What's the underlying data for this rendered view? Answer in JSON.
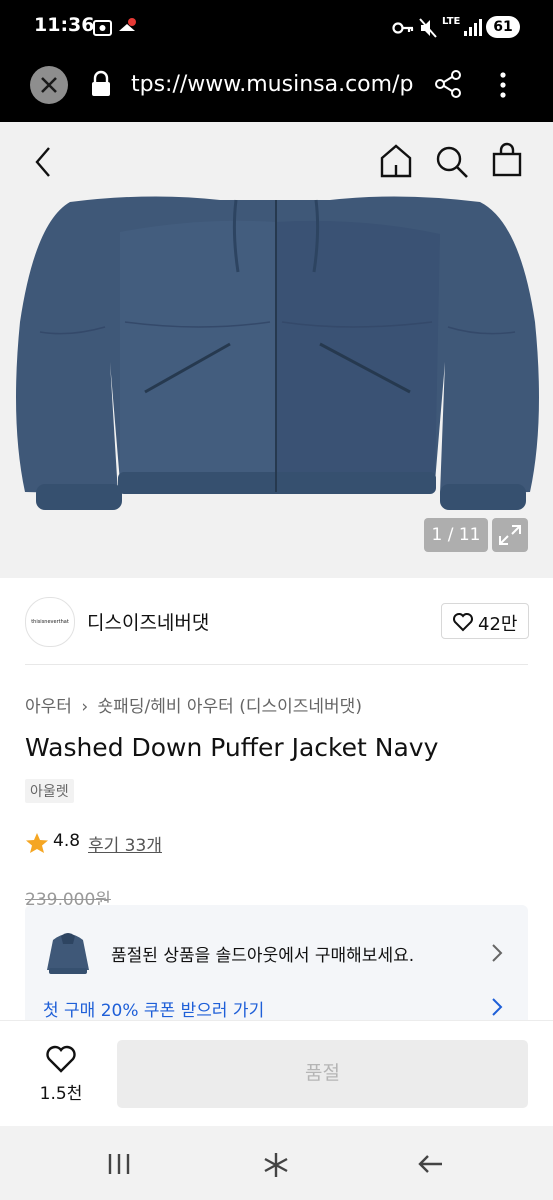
{
  "status_bar": {
    "time": "11:36",
    "network": "LTE",
    "battery": "61"
  },
  "browser": {
    "url": "tps://www.musinsa.com/p"
  },
  "gallery": {
    "counter": "1 / 11"
  },
  "brand": {
    "name": "디스이즈네버댓",
    "logo_text": "thisisneverthat",
    "likes": "42만"
  },
  "breadcrumb": {
    "category": "아우터",
    "sub": "숏패딩/헤비 아우터 (디스이즈네버댓)"
  },
  "product": {
    "title": "Washed Down Puffer Jacket Navy",
    "tag": "아울렛",
    "rating": "4.8",
    "reviews": "후기 33개",
    "original_price": "239,000원"
  },
  "soldout_card": {
    "message": "품절된 상품을 솔드아웃에서 구매해보세요.",
    "coupon": "첫 구매 20% 쿠폰 받으러 가기"
  },
  "action_bar": {
    "like_count": "1.5천",
    "buy_label": "품절"
  },
  "colors": {
    "accent_blue": "#1e5fd8",
    "jacket_navy": "#3f5878",
    "star": "#f5a623"
  }
}
